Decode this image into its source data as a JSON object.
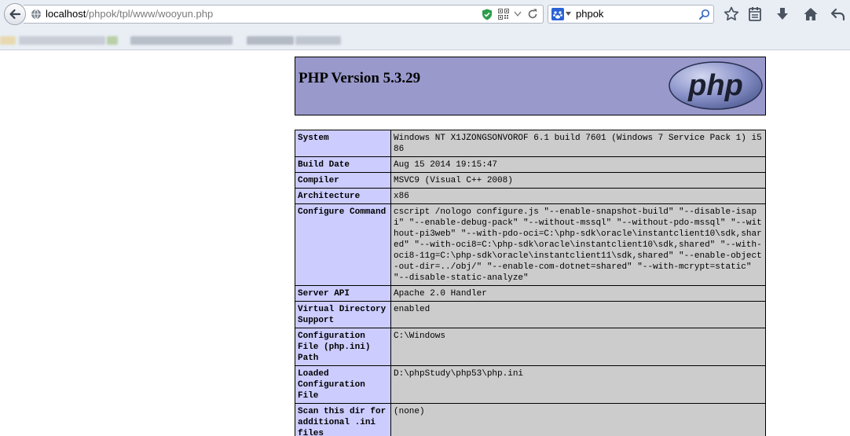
{
  "browser": {
    "url_host": "localhost",
    "url_path": "/phpok/tpl/www/wooyun.php",
    "search_query": "phpok",
    "icons": {
      "back": "back-arrow-icon",
      "globe": "globe-icon",
      "shield": "shield-check-icon",
      "qr": "qr-code-icon",
      "reload": "reload-icon",
      "search": "search-icon",
      "bookmark": "star-icon",
      "reading_list": "reading-list-icon",
      "downloads": "download-icon",
      "home": "home-icon",
      "undo": "undo-arrow-icon"
    }
  },
  "php": {
    "title": "PHP Version 5.3.29",
    "logo_text": "php",
    "colors": {
      "header": "#9999cc",
      "key_cell": "#ccccff",
      "value_cell": "#cccccc"
    },
    "rows": [
      {
        "key": "System",
        "value": "Windows NT X1JZONGSONVOROF 6.1 build 7601 (Windows 7 Service Pack 1) i586"
      },
      {
        "key": "Build Date",
        "value": "Aug 15 2014 19:15:47"
      },
      {
        "key": "Compiler",
        "value": "MSVC9 (Visual C++ 2008)"
      },
      {
        "key": "Architecture",
        "value": "x86"
      },
      {
        "key": "Configure Command",
        "value": "cscript /nologo configure.js \"--enable-snapshot-build\" \"--disable-isapi\" \"--enable-debug-pack\" \"--without-mssql\" \"--without-pdo-mssql\" \"--without-pi3web\" \"--with-pdo-oci=C:\\php-sdk\\oracle\\instantclient10\\sdk,shared\" \"--with-oci8=C:\\php-sdk\\oracle\\instantclient10\\sdk,shared\" \"--with-oci8-11g=C:\\php-sdk\\oracle\\instantclient11\\sdk,shared\" \"--enable-object-out-dir=../obj/\" \"--enable-com-dotnet=shared\" \"--with-mcrypt=static\" \"--disable-static-analyze\""
      },
      {
        "key": "Server API",
        "value": "Apache 2.0 Handler"
      },
      {
        "key": "Virtual Directory Support",
        "value": "enabled"
      },
      {
        "key": "Configuration File (php.ini) Path",
        "value": "C:\\Windows"
      },
      {
        "key": "Loaded Configuration File",
        "value": "D:\\phpStudy\\php53\\php.ini"
      },
      {
        "key": "Scan this dir for additional .ini files",
        "value": "(none)"
      }
    ]
  }
}
